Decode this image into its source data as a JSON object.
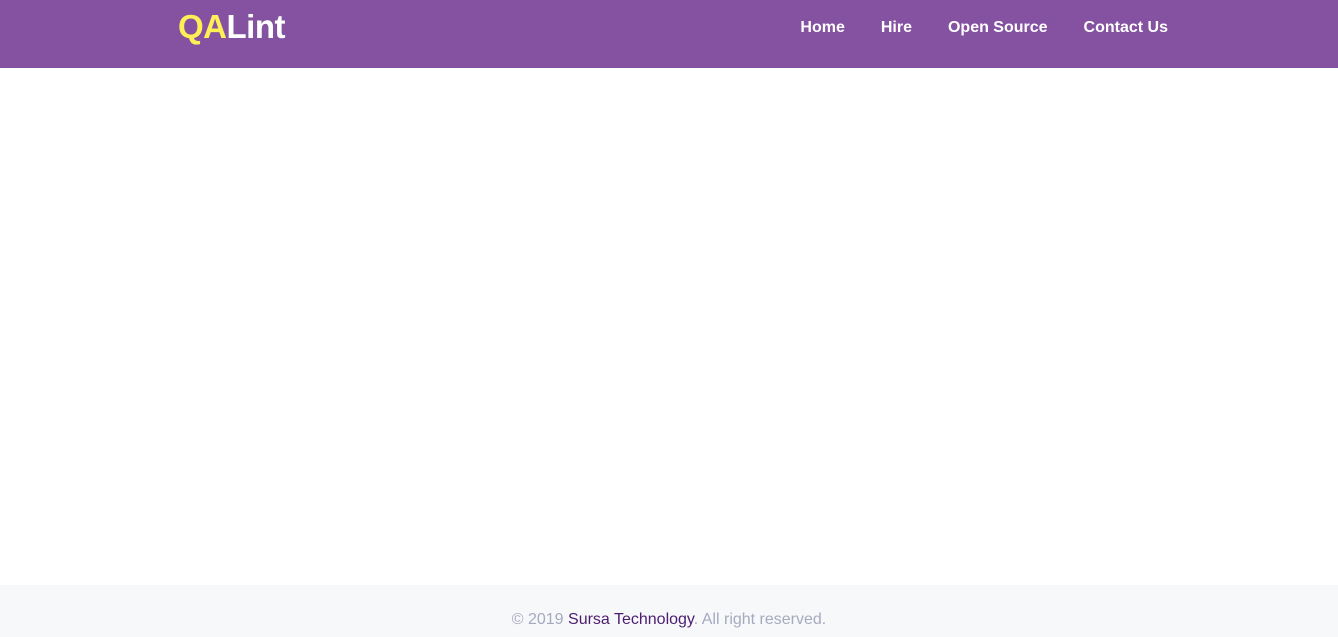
{
  "header": {
    "brand_part1": "QA",
    "brand_part2": "Lint",
    "nav": [
      {
        "label": "Home"
      },
      {
        "label": "Hire"
      },
      {
        "label": "Open Source"
      },
      {
        "label": "Contact Us"
      }
    ]
  },
  "footer": {
    "copyright_prefix": "© 2019 ",
    "company_link": "Sursa Technology",
    "copyright_suffix": ". All right reserved."
  },
  "colors": {
    "navbar_bg": "#8552a1",
    "brand_accent": "#ffee55",
    "footer_bg": "#f7f8fa",
    "footer_text": "#a7a9bf",
    "footer_link": "#4b1d6e"
  }
}
